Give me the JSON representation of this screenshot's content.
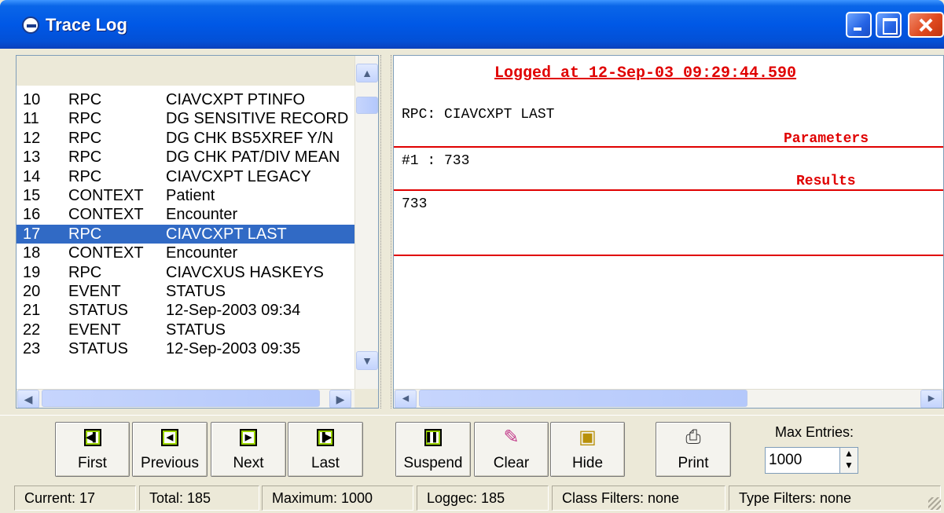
{
  "window": {
    "title": "Trace Log"
  },
  "list": {
    "rows": [
      {
        "num": "10",
        "type": "RPC",
        "name": "CIAVCXPT PTINFO"
      },
      {
        "num": "11",
        "type": "RPC",
        "name": "DG SENSITIVE RECORD"
      },
      {
        "num": "12",
        "type": "RPC",
        "name": "DG CHK BS5XREF Y/N"
      },
      {
        "num": "13",
        "type": "RPC",
        "name": "DG CHK PAT/DIV MEAN"
      },
      {
        "num": "14",
        "type": "RPC",
        "name": "CIAVCXPT LEGACY"
      },
      {
        "num": "15",
        "type": "CONTEXT",
        "name": "Patient"
      },
      {
        "num": "16",
        "type": "CONTEXT",
        "name": "Encounter"
      },
      {
        "num": "17",
        "type": "RPC",
        "name": "CIAVCXPT LAST"
      },
      {
        "num": "18",
        "type": "CONTEXT",
        "name": "Encounter"
      },
      {
        "num": "19",
        "type": "RPC",
        "name": "CIAVCXUS HASKEYS"
      },
      {
        "num": "20",
        "type": "EVENT",
        "name": "STATUS"
      },
      {
        "num": "21",
        "type": "STATUS",
        "name": "12-Sep-2003 09:34"
      },
      {
        "num": "22",
        "type": "EVENT",
        "name": "STATUS"
      },
      {
        "num": "23",
        "type": "STATUS",
        "name": "12-Sep-2003 09:35"
      }
    ],
    "selected_num": "17"
  },
  "detail": {
    "logged": "Logged at 12-Sep-03 09:29:44.590",
    "rpc_line": "RPC: CIAVCXPT LAST",
    "parameters_title": "Parameters",
    "param_line": "#1 : 733",
    "results_title": "Results",
    "result_line": "733"
  },
  "toolbar": {
    "first": "First",
    "previous": "Previous",
    "next": "Next",
    "last": "Last",
    "suspend": "Suspend",
    "clear": "Clear",
    "hide": "Hide",
    "print": "Print",
    "max_entries_label": "Max Entries:",
    "max_entries_value": "1000"
  },
  "status": {
    "current": "Current: 17",
    "total": "Total: 185",
    "maximum": "Maximum: 1000",
    "loggec": "Loggec: 185",
    "class_filters": "Class Filters: none",
    "type_filters": "Type Filters: none"
  },
  "icons": {
    "first": "skip-first-icon",
    "previous": "step-back-icon",
    "next": "step-forward-icon",
    "last": "skip-last-icon",
    "suspend": "pause-icon",
    "clear": "eraser-icon",
    "hide": "hide-icon",
    "print": "printer-icon"
  },
  "colors": {
    "accent_red": "#e00000",
    "selection": "#316AC5",
    "title_bar": "#0058E6"
  }
}
